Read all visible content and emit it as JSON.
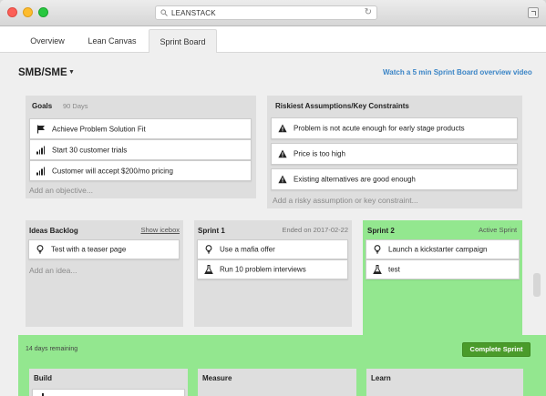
{
  "browser": {
    "url": "LEANSTACK"
  },
  "tabs": [
    {
      "label": "Overview"
    },
    {
      "label": "Lean Canvas"
    },
    {
      "label": "Sprint Board",
      "active": true
    }
  ],
  "header": {
    "segment": "SMB/SME",
    "video_link": "Watch a 5 min Sprint Board overview video"
  },
  "goals": {
    "title": "Goals",
    "subtitle": "90 Days",
    "items": [
      {
        "icon": "flag-icon",
        "text": "Achieve Problem Solution Fit"
      },
      {
        "icon": "signal-bars-icon",
        "text": "Start 30 customer trials"
      },
      {
        "icon": "signal-bars-icon",
        "text": "Customer will accept $200/mo pricing"
      }
    ],
    "add_placeholder": "Add an objective..."
  },
  "risks": {
    "title": "Riskiest Assumptions/Key Constraints",
    "items": [
      {
        "icon": "warning-icon",
        "text": "Problem is not acute enough for early stage products"
      },
      {
        "icon": "warning-icon",
        "text": "Price is too high"
      },
      {
        "icon": "warning-icon",
        "text": "Existing alternatives are good enough"
      }
    ],
    "add_placeholder": "Add a risky assumption or key constraint..."
  },
  "ideas_backlog": {
    "title": "Ideas Backlog",
    "link": "Show icebox",
    "items": [
      {
        "icon": "lightbulb-icon",
        "text": "Test with a teaser page"
      }
    ],
    "add_placeholder": "Add an idea..."
  },
  "sprint1": {
    "title": "Sprint 1",
    "status": "Ended on 2017-02-22",
    "items": [
      {
        "icon": "lightbulb-icon",
        "text": "Use a mafia offer"
      },
      {
        "icon": "flask-icon",
        "text": "Run 10 problem interviews"
      }
    ]
  },
  "sprint2": {
    "title": "Sprint 2",
    "status": "Active Sprint",
    "items": [
      {
        "icon": "lightbulb-icon",
        "text": "Launch a kickstarter campaign"
      },
      {
        "icon": "flask-icon",
        "text": "test"
      }
    ]
  },
  "active_sprint": {
    "days_remaining": "14 days remaining",
    "complete_button": "Complete Sprint",
    "columns": [
      {
        "title": "Build"
      },
      {
        "title": "Measure"
      },
      {
        "title": "Learn"
      }
    ]
  },
  "colors": {
    "accent_link": "#3b85c6",
    "active_green": "#93e78f",
    "button_green": "#4a9b2a"
  }
}
